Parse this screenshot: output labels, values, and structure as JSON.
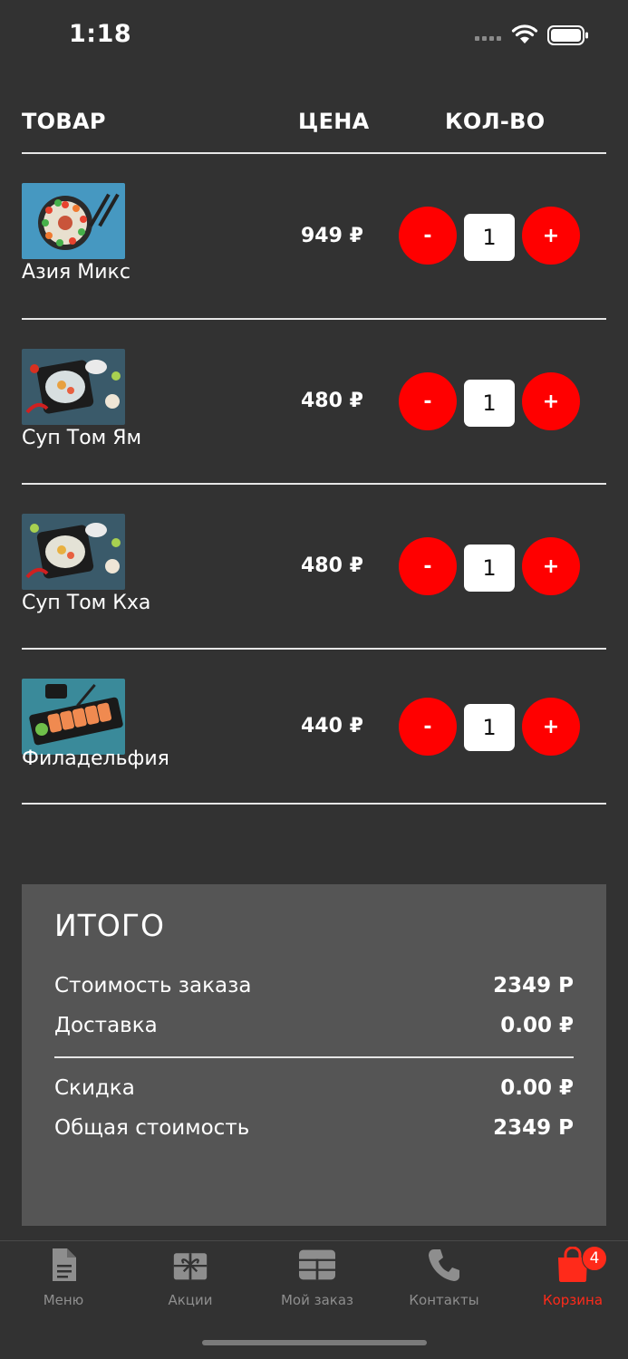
{
  "status_bar": {
    "time": "1:18"
  },
  "table_header": {
    "product": "ТОВАР",
    "price": "ЦЕНА",
    "quantity": "КОЛ-ВО"
  },
  "items": [
    {
      "name": "Азия Микс",
      "price": "949 ₽",
      "quantity": "1",
      "minus": "-",
      "plus": "+",
      "image": "sushi-set-image"
    },
    {
      "name": "Суп Том Ям",
      "price": "480 ₽",
      "quantity": "1",
      "minus": "-",
      "plus": "+",
      "image": "soup-image"
    },
    {
      "name": "Суп Том Кха",
      "price": "480 ₽",
      "quantity": "1",
      "minus": "-",
      "plus": "+",
      "image": "soup-image"
    },
    {
      "name": "Филадельфия",
      "price": "440 ₽",
      "quantity": "1",
      "minus": "-",
      "plus": "+",
      "image": "rolls-image"
    }
  ],
  "summary": {
    "title": "ИТОГО",
    "order_cost_label": "Стоимость заказа",
    "order_cost_value": "2349 Р",
    "delivery_label": "Доставка",
    "delivery_value": "0.00 ₽",
    "discount_label": "Скидка",
    "discount_value": "0.00 ₽",
    "total_label": "Общая стоимость",
    "total_value": "2349 Р"
  },
  "tabs": [
    {
      "label": "Меню",
      "icon": "document-icon"
    },
    {
      "label": "Акции",
      "icon": "gift-icon"
    },
    {
      "label": "Мой заказ",
      "icon": "grid-icon"
    },
    {
      "label": "Контакты",
      "icon": "phone-icon"
    },
    {
      "label": "Корзина",
      "icon": "shopping-bag-icon",
      "badge": "4",
      "active": true
    }
  ],
  "colors": {
    "background": "#323232",
    "accent": "#ff0000",
    "active_tab": "#ff2a1a",
    "summary_panel": "#555555",
    "inactive_tab": "#8e8e8e"
  }
}
